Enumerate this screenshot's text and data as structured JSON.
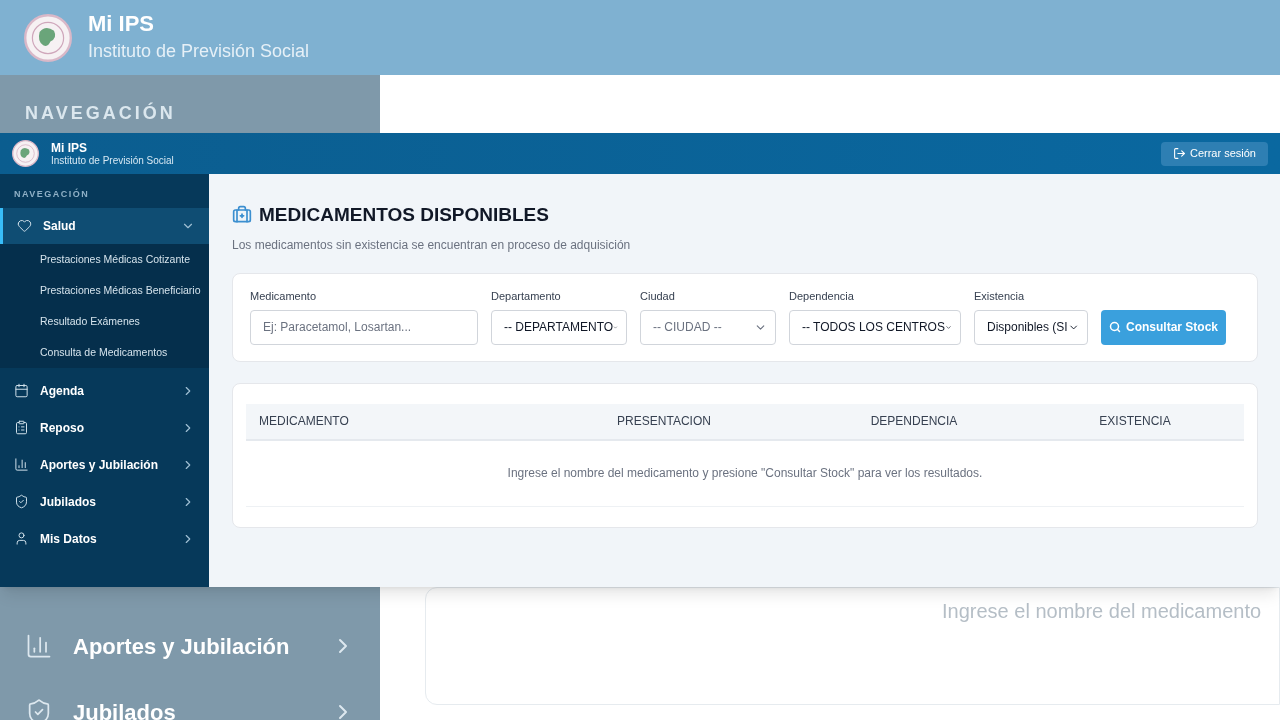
{
  "background": {
    "brand": {
      "title": "Mi IPS",
      "subtitle": "Instituto de Previsión Social"
    },
    "nav_heading": "NAVEGACIÓN",
    "nav": [
      {
        "label": "Aportes y Jubilación"
      },
      {
        "label": "Jubilados"
      }
    ],
    "empty_message": "Ingrese el nombre del medicamento"
  },
  "window": {
    "brand": {
      "title": "Mi IPS",
      "subtitle": "Instituto de Previsión Social"
    },
    "logout": "Cerrar sesión",
    "nav_heading": "NAVEGACIÓN",
    "nav": [
      {
        "label": "Salud",
        "selected": true,
        "expanded": true,
        "children": [
          {
            "label": "Prestaciones Médicas Cotizante"
          },
          {
            "label": "Prestaciones Médicas Beneficiario"
          },
          {
            "label": "Resultado Exámenes"
          },
          {
            "label": "Consulta de Medicamentos"
          }
        ]
      },
      {
        "label": "Agenda",
        "selected": false,
        "expanded": false
      },
      {
        "label": "Reposo",
        "selected": false,
        "expanded": false
      },
      {
        "label": "Aportes y Jubilación",
        "selected": false,
        "expanded": false
      },
      {
        "label": "Jubilados",
        "selected": false,
        "expanded": false
      },
      {
        "label": "Mis Datos",
        "selected": false,
        "expanded": false
      }
    ],
    "page": {
      "title": "MEDICAMENTOS DISPONIBLES",
      "subtitle": "Los medicamentos sin existencia se encuentran en proceso de adquisición",
      "filters": [
        {
          "kind": "input",
          "label": "Medicamento",
          "placeholder": "Ej: Paracetamol, Losartan..."
        },
        {
          "kind": "select",
          "label": "Departamento",
          "value": "-- DEPARTAMENTO"
        },
        {
          "kind": "select",
          "label": "Ciudad",
          "value": "-- CIUDAD --",
          "disabled": true
        },
        {
          "kind": "select",
          "label": "Dependencia",
          "value": "-- TODOS LOS CENTROS"
        },
        {
          "kind": "select",
          "label": "Existencia",
          "value": "Disponibles (SI"
        }
      ],
      "search_button": "Consultar Stock",
      "table": {
        "columns": [
          "MEDICAMENTO",
          "PRESENTACION",
          "DEPENDENCIA",
          "EXISTENCIA"
        ],
        "empty_message": "Ingrese el nombre del medicamento y presione \"Consultar Stock\" para ver los resultados."
      }
    }
  }
}
